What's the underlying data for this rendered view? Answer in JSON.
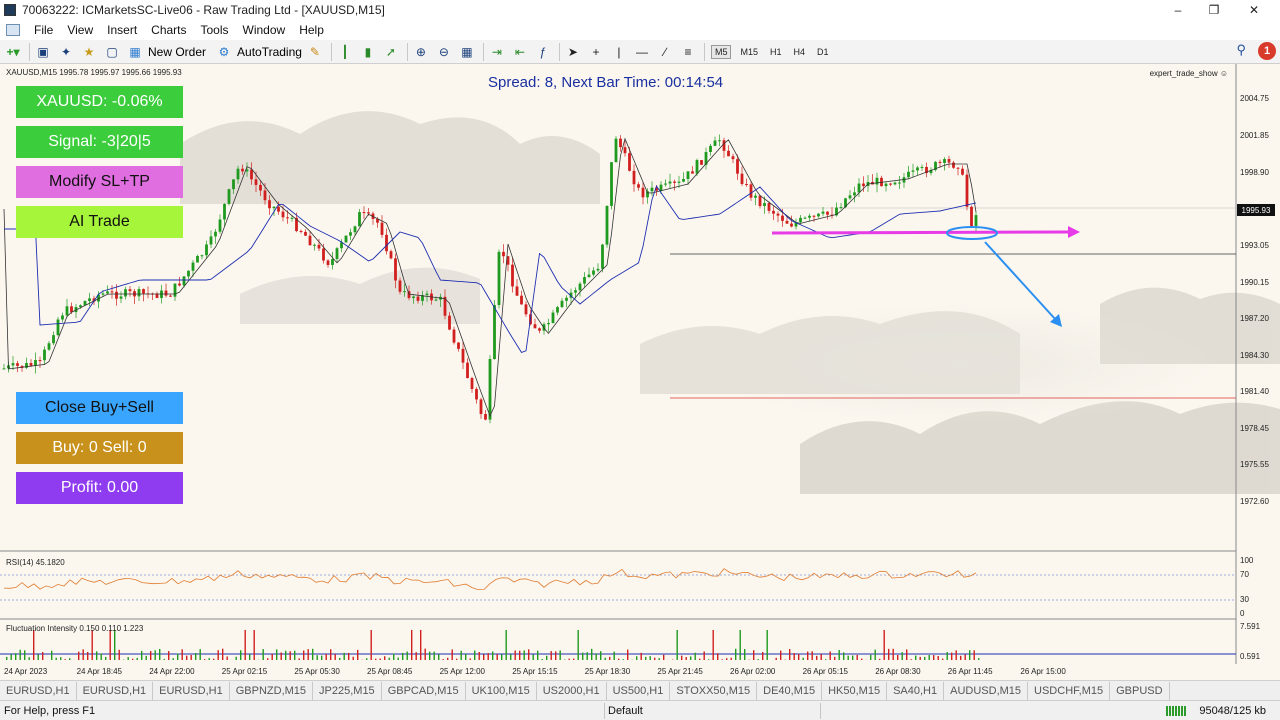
{
  "window": {
    "title": "70063222: ICMarketsSC-Live06 - Raw Trading Ltd - [XAUUSD,M15]",
    "controls": [
      "–",
      "❐",
      "✕"
    ]
  },
  "menu": [
    "File",
    "View",
    "Insert",
    "Charts",
    "Tools",
    "Window",
    "Help"
  ],
  "toolbar": {
    "new_order_label": "New Order",
    "autotrading_label": "AutoTrading",
    "timeframes": [
      "M5",
      "M15",
      "H1",
      "H4",
      "D1"
    ],
    "active_timeframe": "M15",
    "alert_count": "1"
  },
  "chart": {
    "symbol_info": "XAUUSD,M15  1995.78 1995.97 1995.66 1995.93",
    "spread_text": "Spread: 8, Next Bar Time: 00:14:54",
    "expert_label": "expert_trade_show ☺",
    "current_price": "1995.93",
    "price_axis": [
      "2004.75",
      "2001.85",
      "1998.90",
      "1993.05",
      "1990.15",
      "1987.20",
      "1984.30",
      "1981.40",
      "1978.45",
      "1975.55",
      "1972.60"
    ],
    "panel_buttons": {
      "symbol_change": "XAUUSD: -0.06%",
      "signal": "Signal: -3|20|5",
      "modify": "Modify SL+TP",
      "ai_trade": "AI Trade",
      "close_all": "Close Buy+Sell",
      "buy_sell": "Buy: 0  Sell: 0",
      "profit": "Profit: 0.00"
    },
    "rsi_label": "RSI(14) 45.1820",
    "rsi_axis": [
      "100",
      "70",
      "30",
      "0"
    ],
    "fi_label": "Fluctuation Intensity 0.150 0.110 1.223",
    "fi_axis": [
      "7.591",
      "0.591"
    ],
    "time_axis": [
      "24 Apr 2023",
      "24 Apr 18:45",
      "24 Apr 22:00",
      "25 Apr 02:15",
      "25 Apr 05:30",
      "25 Apr 08:45",
      "25 Apr 12:00",
      "25 Apr 15:15",
      "25 Apr 18:30",
      "25 Apr 21:45",
      "26 Apr 02:00",
      "26 Apr 05:15",
      "26 Apr 08:30",
      "26 Apr 11:45",
      "26 Apr 15:00"
    ],
    "colors": {
      "bull": "#1f9a1f",
      "bear": "#d11f1f",
      "ma_fast": "#333333",
      "ma_slow": "#1e2fb0",
      "rsi": "#e07b2f",
      "arrow_pink": "#e83be8",
      "arrow_blue": "#2a8ff0"
    }
  },
  "tabs": [
    "EURUSD,H1",
    "EURUSD,H1",
    "EURUSD,H1",
    "GBPNZD,M15",
    "JP225,M15",
    "GBPCAD,M15",
    "UK100,M15",
    "US2000,H1",
    "US500,H1",
    "STOXX50,M15",
    "DE40,M15",
    "HK50,M15",
    "SA40,H1",
    "AUDUSD,M15",
    "USDCHF,M15",
    "GBPUSD"
  ],
  "status": {
    "help": "For Help, press F1",
    "profile": "Default",
    "traffic": "95048/125 kb"
  }
}
